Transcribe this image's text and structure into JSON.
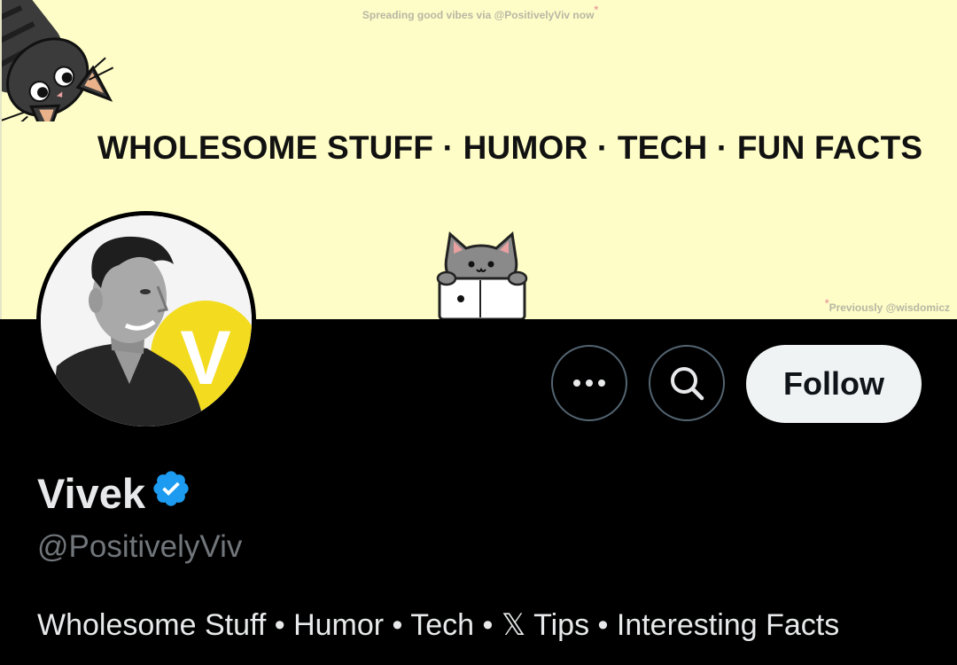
{
  "banner": {
    "top_note": "Spreading good vibes via @PositivelyViv now",
    "asterisk": "*",
    "headline": "WHOLESOME STUFF · HUMOR · TECH · FUN FACTS",
    "prev_note": "Previously @wisdomicz",
    "bg_color": "#fefdc7"
  },
  "avatar": {
    "badge_letter": "V",
    "badge_color": "#f3dc1f"
  },
  "actions": {
    "more_icon": "more-horizontal-icon",
    "search_icon": "search-icon",
    "follow_label": "Follow"
  },
  "profile": {
    "display_name": "Vivek",
    "verified_icon": "verified-badge-icon",
    "verified_color": "#1d9bf0",
    "handle": "@PositivelyViv",
    "bio": "Wholesome Stuff • Humor • Tech • 𝕏 Tips • Interesting Facts"
  }
}
